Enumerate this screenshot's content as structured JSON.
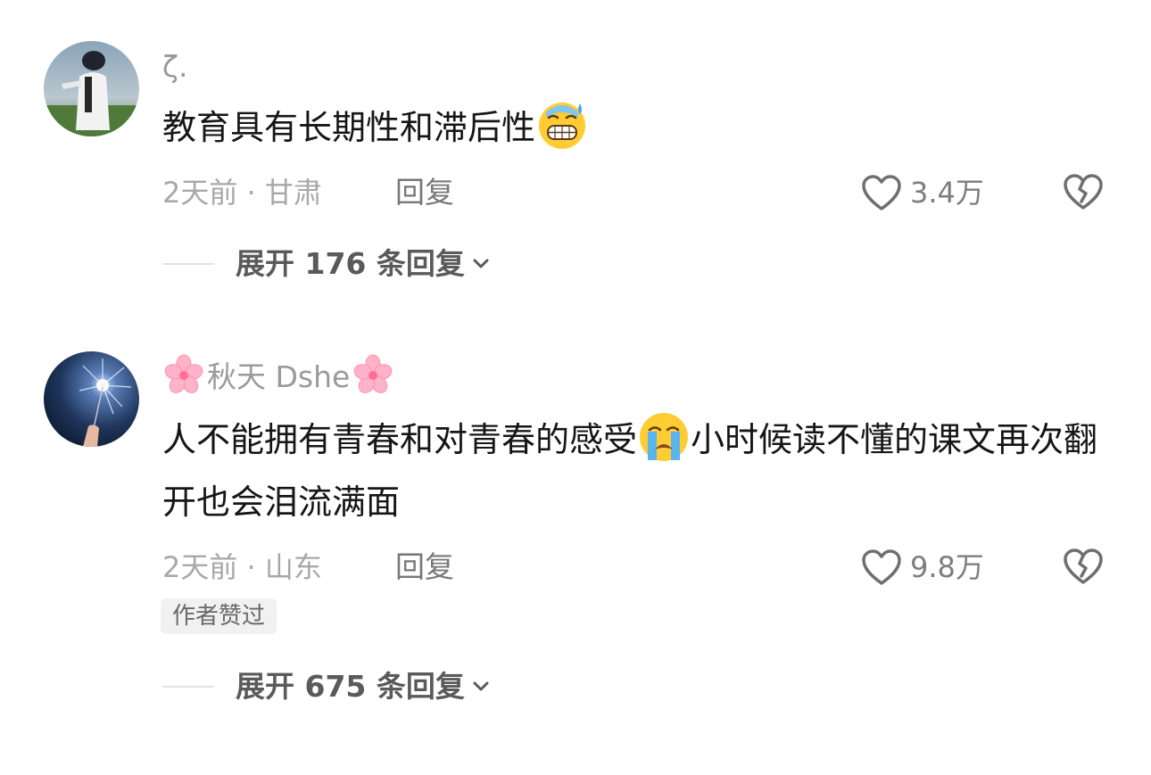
{
  "comments": [
    {
      "username": "ζ.",
      "text": "教育具有长期性和滞后性",
      "emoji": "grimacing-sweat-emoji",
      "time": "2天前",
      "location": "甘肃",
      "meta_separator": " · ",
      "reply_label": "回复",
      "likes": "3.4万",
      "expand_label": "展开 176 条回复"
    },
    {
      "username": "秋天 Dshe",
      "username_decoration": "cherry-blossom-emoji",
      "text_before_emoji": "人不能拥有青春和对青春的感受",
      "emoji": "crying-face-emoji",
      "text_after_emoji": "小时候读不懂的课文再次翻开也会泪流满面",
      "time": "2天前",
      "location": "山东",
      "meta_separator": " · ",
      "reply_label": "回复",
      "likes": "9.8万",
      "badge": "作者赞过",
      "expand_label": "展开 675 条回复"
    }
  ],
  "icons": {
    "like": "heart-outline-icon",
    "dislike": "broken-heart-icon",
    "expand": "chevron-down-icon"
  },
  "colors": {
    "background": "#ffffff",
    "text": "#161616",
    "secondary": "#a8a8a8",
    "badge_bg": "#f1f1f1"
  }
}
